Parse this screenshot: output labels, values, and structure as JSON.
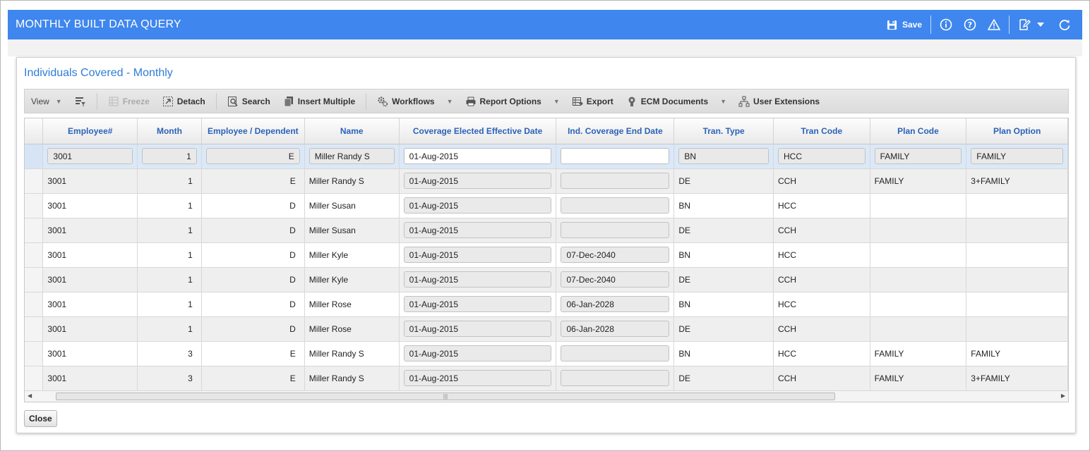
{
  "header": {
    "title": "MONTHLY BUILT DATA QUERY",
    "save_label": "Save"
  },
  "section": {
    "title": "Individuals Covered - Monthly"
  },
  "toolbar": {
    "view": "View",
    "freeze": "Freeze",
    "detach": "Detach",
    "search": "Search",
    "insert_multiple": "Insert Multiple",
    "workflows": "Workflows",
    "report_options": "Report Options",
    "export": "Export",
    "ecm_documents": "ECM Documents",
    "user_extensions": "User Extensions"
  },
  "table": {
    "columns": [
      "Employee#",
      "Month",
      "Employee / Dependent",
      "Name",
      "Coverage Elected Effective Date",
      "Ind. Coverage End Date",
      "Tran. Type",
      "Tran Code",
      "Plan Code",
      "Plan Option"
    ],
    "rows": [
      [
        "3001",
        "1",
        "E",
        "Miller Randy S",
        "01-Aug-2015",
        "",
        "BN",
        "HCC",
        "FAMILY",
        "FAMILY"
      ],
      [
        "3001",
        "1",
        "E",
        "Miller Randy S",
        "01-Aug-2015",
        "",
        "DE",
        "CCH",
        "FAMILY",
        "3+FAMILY"
      ],
      [
        "3001",
        "1",
        "D",
        "Miller Susan",
        "01-Aug-2015",
        "",
        "BN",
        "HCC",
        "",
        ""
      ],
      [
        "3001",
        "1",
        "D",
        "Miller Susan",
        "01-Aug-2015",
        "",
        "DE",
        "CCH",
        "",
        ""
      ],
      [
        "3001",
        "1",
        "D",
        "Miller Kyle",
        "01-Aug-2015",
        "07-Dec-2040",
        "BN",
        "HCC",
        "",
        ""
      ],
      [
        "3001",
        "1",
        "D",
        "Miller Kyle",
        "01-Aug-2015",
        "07-Dec-2040",
        "DE",
        "CCH",
        "",
        ""
      ],
      [
        "3001",
        "1",
        "D",
        "Miller Rose",
        "01-Aug-2015",
        "06-Jan-2028",
        "BN",
        "HCC",
        "",
        ""
      ],
      [
        "3001",
        "1",
        "D",
        "Miller Rose",
        "01-Aug-2015",
        "06-Jan-2028",
        "DE",
        "CCH",
        "",
        ""
      ],
      [
        "3001",
        "3",
        "E",
        "Miller Randy S",
        "01-Aug-2015",
        "",
        "BN",
        "HCC",
        "FAMILY",
        "FAMILY"
      ],
      [
        "3001",
        "3",
        "E",
        "Miller Randy S",
        "01-Aug-2015",
        "",
        "DE",
        "CCH",
        "FAMILY",
        "3+FAMILY"
      ]
    ]
  },
  "footer": {
    "close_label": "Close"
  },
  "colors": {
    "accent": "#3f86ee",
    "link": "#2f7cd6",
    "header_text": "#2b62b8"
  }
}
